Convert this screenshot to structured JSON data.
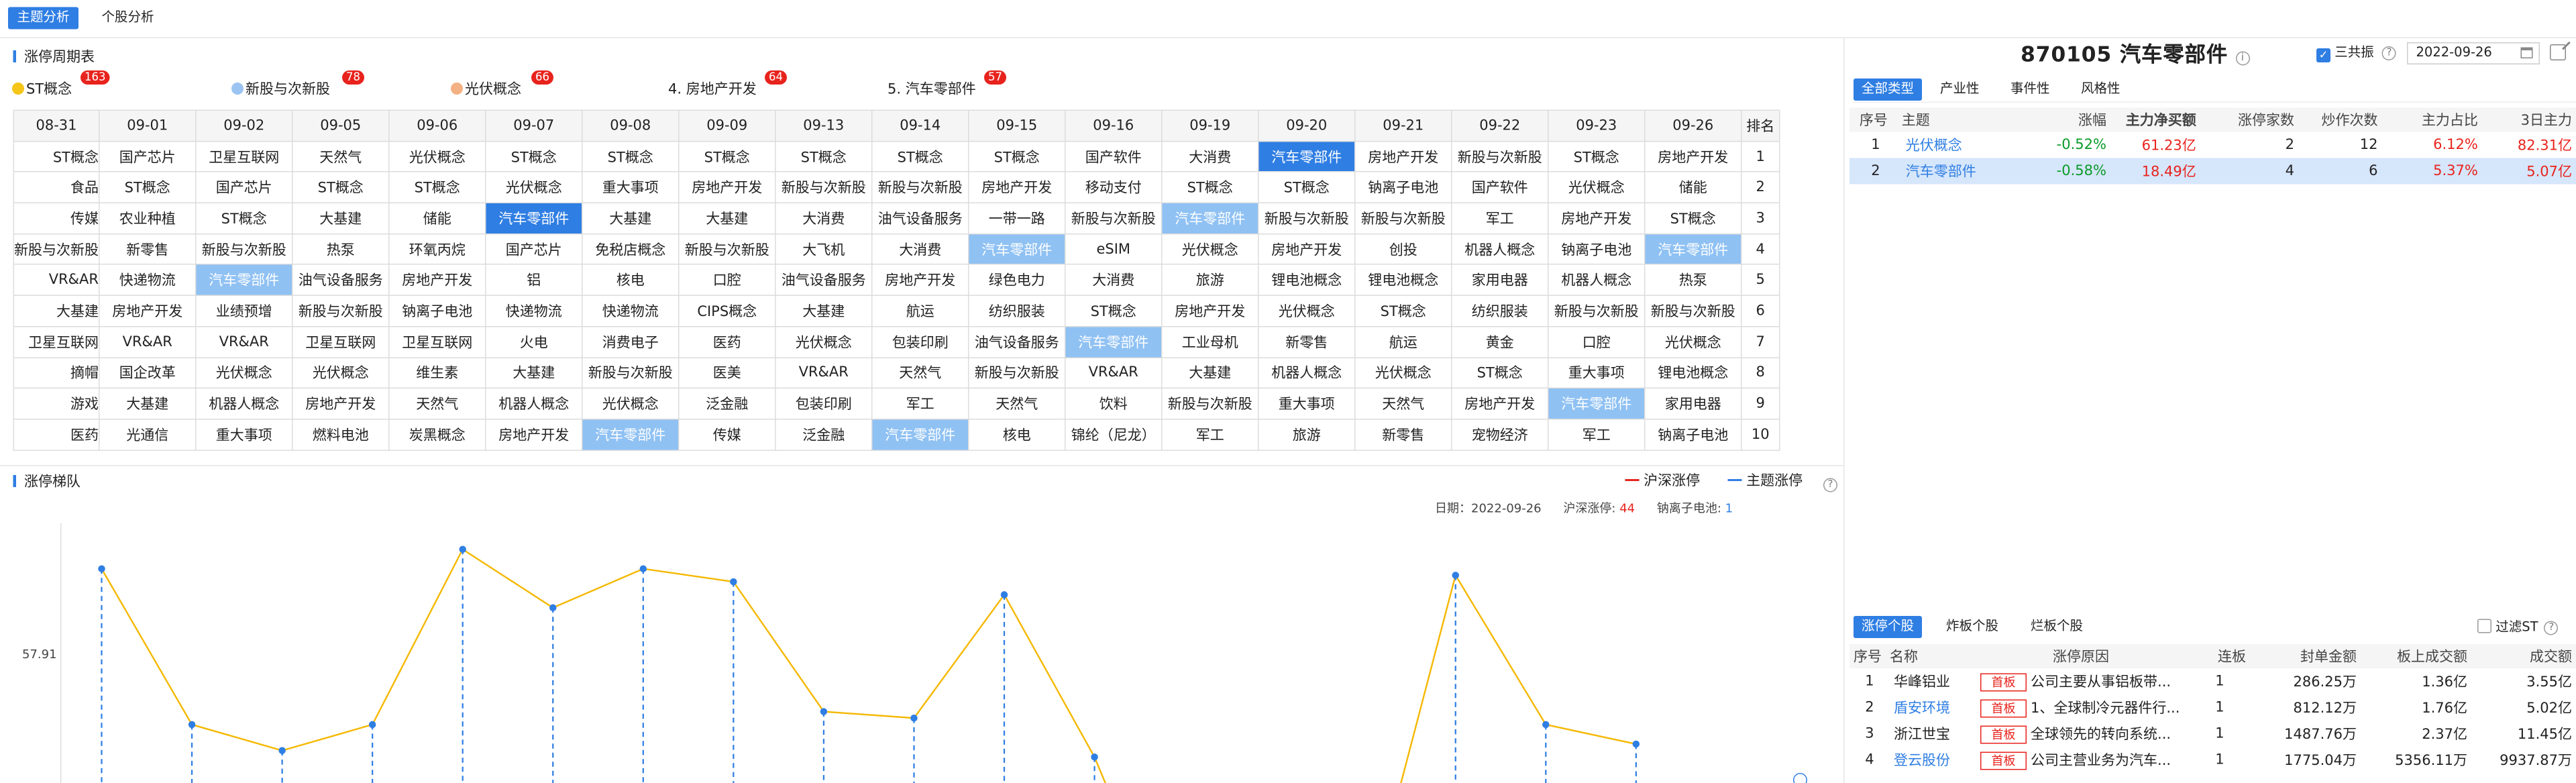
{
  "top_tabs": [
    {
      "label": "主题分析"
    },
    {
      "label": "个股分析"
    }
  ],
  "cycle": {
    "title": "涨停周期表",
    "legend": [
      {
        "label": "ST概念",
        "count": "163",
        "color": "#f5c518"
      },
      {
        "label": "新股与次新股",
        "count": "78",
        "color": "#9bc4f2"
      },
      {
        "label": "光伏概念",
        "count": "66",
        "color": "#f4b183"
      },
      {
        "label": "4. 房地产开发",
        "count": "64"
      },
      {
        "label": "5. 汽车零部件",
        "count": "57"
      }
    ],
    "headers": [
      "08-31",
      "09-01",
      "09-02",
      "09-05",
      "09-06",
      "09-07",
      "09-08",
      "09-09",
      "09-13",
      "09-14",
      "09-15",
      "09-16",
      "09-19",
      "09-20",
      "09-21",
      "09-22",
      "09-23",
      "09-26",
      "排名"
    ],
    "rows": [
      [
        "ST概念",
        "国产芯片",
        "卫星互联网",
        "天然气",
        "光伏概念",
        "ST概念",
        "ST概念",
        "ST概念",
        "ST概念",
        "ST概念",
        "ST概念",
        "国产软件",
        "大消费",
        "汽车零部件",
        "房地产开发",
        "新股与次新股",
        "ST概念",
        "房地产开发",
        "1"
      ],
      [
        "食品",
        "ST概念",
        "国产芯片",
        "ST概念",
        "ST概念",
        "光伏概念",
        "重大事项",
        "房地产开发",
        "新股与次新股",
        "新股与次新股",
        "房地产开发",
        "移动支付",
        "ST概念",
        "ST概念",
        "钠离子电池",
        "国产软件",
        "光伏概念",
        "储能",
        "2"
      ],
      [
        "传媒",
        "农业种植",
        "ST概念",
        "大基建",
        "储能",
        "汽车零部件",
        "大基建",
        "大基建",
        "大消费",
        "油气设备服务",
        "一带一路",
        "新股与次新股",
        "汽车零部件",
        "新股与次新股",
        "新股与次新股",
        "军工",
        "房地产开发",
        "ST概念",
        "3"
      ],
      [
        "新股与次新股",
        "新零售",
        "新股与次新股",
        "热泵",
        "环氧丙烷",
        "国产芯片",
        "免税店概念",
        "新股与次新股",
        "大飞机",
        "大消费",
        "汽车零部件",
        "eSIM",
        "光伏概念",
        "房地产开发",
        "创投",
        "机器人概念",
        "钠离子电池",
        "汽车零部件",
        "4"
      ],
      [
        "VR&AR",
        "快递物流",
        "汽车零部件",
        "油气设备服务",
        "房地产开发",
        "铝",
        "核电",
        "口腔",
        "油气设备服务",
        "房地产开发",
        "绿色电力",
        "大消费",
        "旅游",
        "锂电池概念",
        "锂电池概念",
        "家用电器",
        "机器人概念",
        "热泵",
        "5"
      ],
      [
        "大基建",
        "房地产开发",
        "业绩预增",
        "新股与次新股",
        "钠离子电池",
        "快递物流",
        "快递物流",
        "CIPS概念",
        "大基建",
        "航运",
        "纺织服装",
        "ST概念",
        "房地产开发",
        "光伏概念",
        "ST概念",
        "纺织服装",
        "新股与次新股",
        "新股与次新股",
        "6"
      ],
      [
        "卫星互联网",
        "VR&AR",
        "VR&AR",
        "卫星互联网",
        "卫星互联网",
        "火电",
        "消费电子",
        "医药",
        "光伏概念",
        "包装印刷",
        "油气设备服务",
        "汽车零部件",
        "工业母机",
        "新零售",
        "航运",
        "黄金",
        "口腔",
        "光伏概念",
        "7"
      ],
      [
        "摘帽",
        "国企改革",
        "光伏概念",
        "光伏概念",
        "维生素",
        "大基建",
        "新股与次新股",
        "医美",
        "VR&AR",
        "天然气",
        "新股与次新股",
        "VR&AR",
        "大基建",
        "机器人概念",
        "光伏概念",
        "ST概念",
        "重大事项",
        "锂电池概念",
        "8"
      ],
      [
        "游戏",
        "大基建",
        "机器人概念",
        "房地产开发",
        "天然气",
        "机器人概念",
        "光伏概念",
        "泛金融",
        "包装印刷",
        "军工",
        "天然气",
        "饮料",
        "新股与次新股",
        "重大事项",
        "天然气",
        "房地产开发",
        "汽车零部件",
        "家用电器",
        "9"
      ],
      [
        "医药",
        "光通信",
        "重大事项",
        "燃料电池",
        "炭黑概念",
        "房地产开发",
        "汽车零部件",
        "传媒",
        "泛金融",
        "汽车零部件",
        "核电",
        "锦纶（尼龙）",
        "军工",
        "旅游",
        "新零售",
        "宠物经济",
        "军工",
        "钠离子电池",
        "10"
      ]
    ]
  },
  "trend": {
    "title": "涨停梯队",
    "legend_a": "沪深涨停",
    "legend_b": "主题涨停",
    "info_date_label": "日期：",
    "info_date": "2022-09-26",
    "info_hs_label": "沪深涨停:",
    "info_hs": "44",
    "info_theme_label": "钠离子电池:",
    "info_theme": "1",
    "y_tick": "57.91"
  },
  "chart_data": {
    "type": "line",
    "x": [
      "08-31",
      "09-01",
      "09-02",
      "09-05",
      "09-06",
      "09-07",
      "09-08",
      "09-09",
      "09-13",
      "09-14",
      "09-15",
      "09-16",
      "09-19",
      "09-20",
      "09-21",
      "09-22",
      "09-23",
      "09-26"
    ],
    "series": [
      {
        "name": "沪深涨停",
        "values": [
          68,
          44,
          40,
          44,
          71,
          62,
          68,
          66,
          46,
          45,
          64,
          39,
          null,
          null,
          null,
          67,
          44,
          41
        ]
      },
      {
        "name": "主题涨停",
        "values": [
          null,
          null,
          null,
          null,
          null,
          null,
          null,
          null,
          null,
          null,
          null,
          null,
          null,
          null,
          null,
          null,
          null,
          null
        ]
      }
    ],
    "yticks": [
      "57.91"
    ],
    "grid": false
  },
  "right": {
    "title": "870105 汽车零部件",
    "checkbox_label": "三共振",
    "date": "2022-09-26",
    "tabs": [
      {
        "label": "全部类型"
      },
      {
        "label": "产业性"
      },
      {
        "label": "事件性"
      },
      {
        "label": "风格性"
      }
    ],
    "theme_headers": [
      "序号",
      "主题",
      "涨幅",
      "主力净买额",
      "涨停家数",
      "炒作次数",
      "主力占比",
      "3日主力"
    ],
    "theme_rows": [
      {
        "idx": "1",
        "name": "光伏概念",
        "chg": "-0.52%",
        "net": "61.23亿",
        "limit": "2",
        "times": "12",
        "ratio": "6.12%",
        "d3": "82.31亿"
      },
      {
        "idx": "2",
        "name": "汽车零部件",
        "chg": "-0.58%",
        "net": "18.49亿",
        "limit": "4",
        "times": "6",
        "ratio": "5.37%",
        "d3": "5.07亿"
      }
    ],
    "stock_tabs": [
      {
        "label": "涨停个股"
      },
      {
        "label": "炸板个股"
      },
      {
        "label": "烂板个股"
      }
    ],
    "filter_label": "过滤ST",
    "stock_headers": [
      "序号",
      "名称",
      "涨停原因",
      "连板",
      "封单金额",
      "板上成交额",
      "成交额"
    ],
    "stock_rows": [
      {
        "idx": "1",
        "name": "华峰铝业",
        "tag": "首板",
        "reason": "公司主要从事铝板带...",
        "streak": "1",
        "seal": "286.25万",
        "board": "1.36亿",
        "amt": "3.55亿"
      },
      {
        "idx": "2",
        "name": "盾安环境",
        "tag": "首板",
        "reason": "1、全球制冷元器件行...",
        "streak": "1",
        "seal": "812.12万",
        "board": "1.76亿",
        "amt": "5.02亿"
      },
      {
        "idx": "3",
        "name": "浙江世宝",
        "tag": "首板",
        "reason": "全球领先的转向系统...",
        "streak": "1",
        "seal": "1487.76万",
        "board": "2.37亿",
        "amt": "11.45亿"
      },
      {
        "idx": "4",
        "name": "登云股份",
        "tag": "首板",
        "reason": "公司主营业务为汽车...",
        "streak": "1",
        "seal": "1775.04万",
        "board": "5356.11万",
        "amt": "9937.87万"
      }
    ]
  }
}
